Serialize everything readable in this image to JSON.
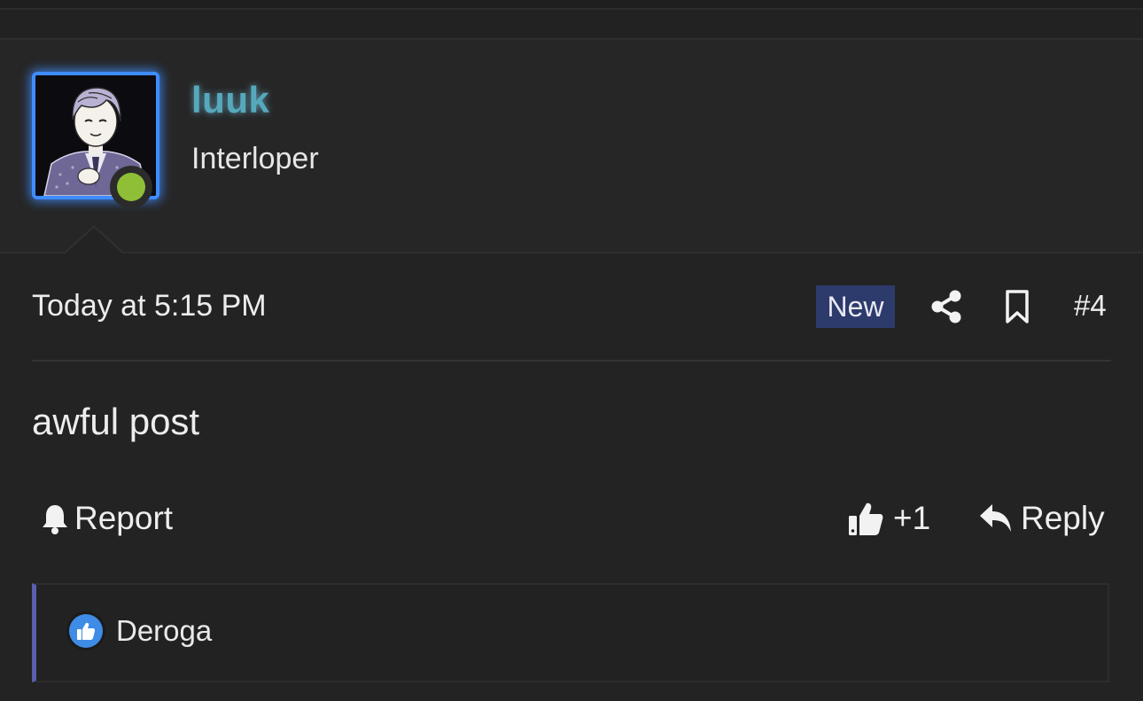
{
  "user": {
    "name": "luuk",
    "title": "Interloper",
    "online": true
  },
  "post": {
    "timestamp": "Today at 5:15 PM",
    "badge": "New",
    "number": "#4",
    "body": "awful post"
  },
  "actions": {
    "report_label": "Report",
    "like_label": "+1",
    "reply_label": "Reply"
  },
  "reactions": {
    "users": [
      "Deroga"
    ]
  },
  "colors": {
    "background": "#232323",
    "username": "#56a9bd",
    "avatar_glow": "#3f8cff",
    "online_dot": "#8fbf36",
    "new_badge": "#2d3a6c",
    "reaction_accent": "#5a5fb0",
    "like_icon_bg": "#3f8ce6"
  },
  "icons": {
    "share": "share-icon",
    "bookmark": "bookmark-icon",
    "report": "bell-icon",
    "like": "thumbs-up-icon",
    "reply": "reply-arrow-icon"
  }
}
